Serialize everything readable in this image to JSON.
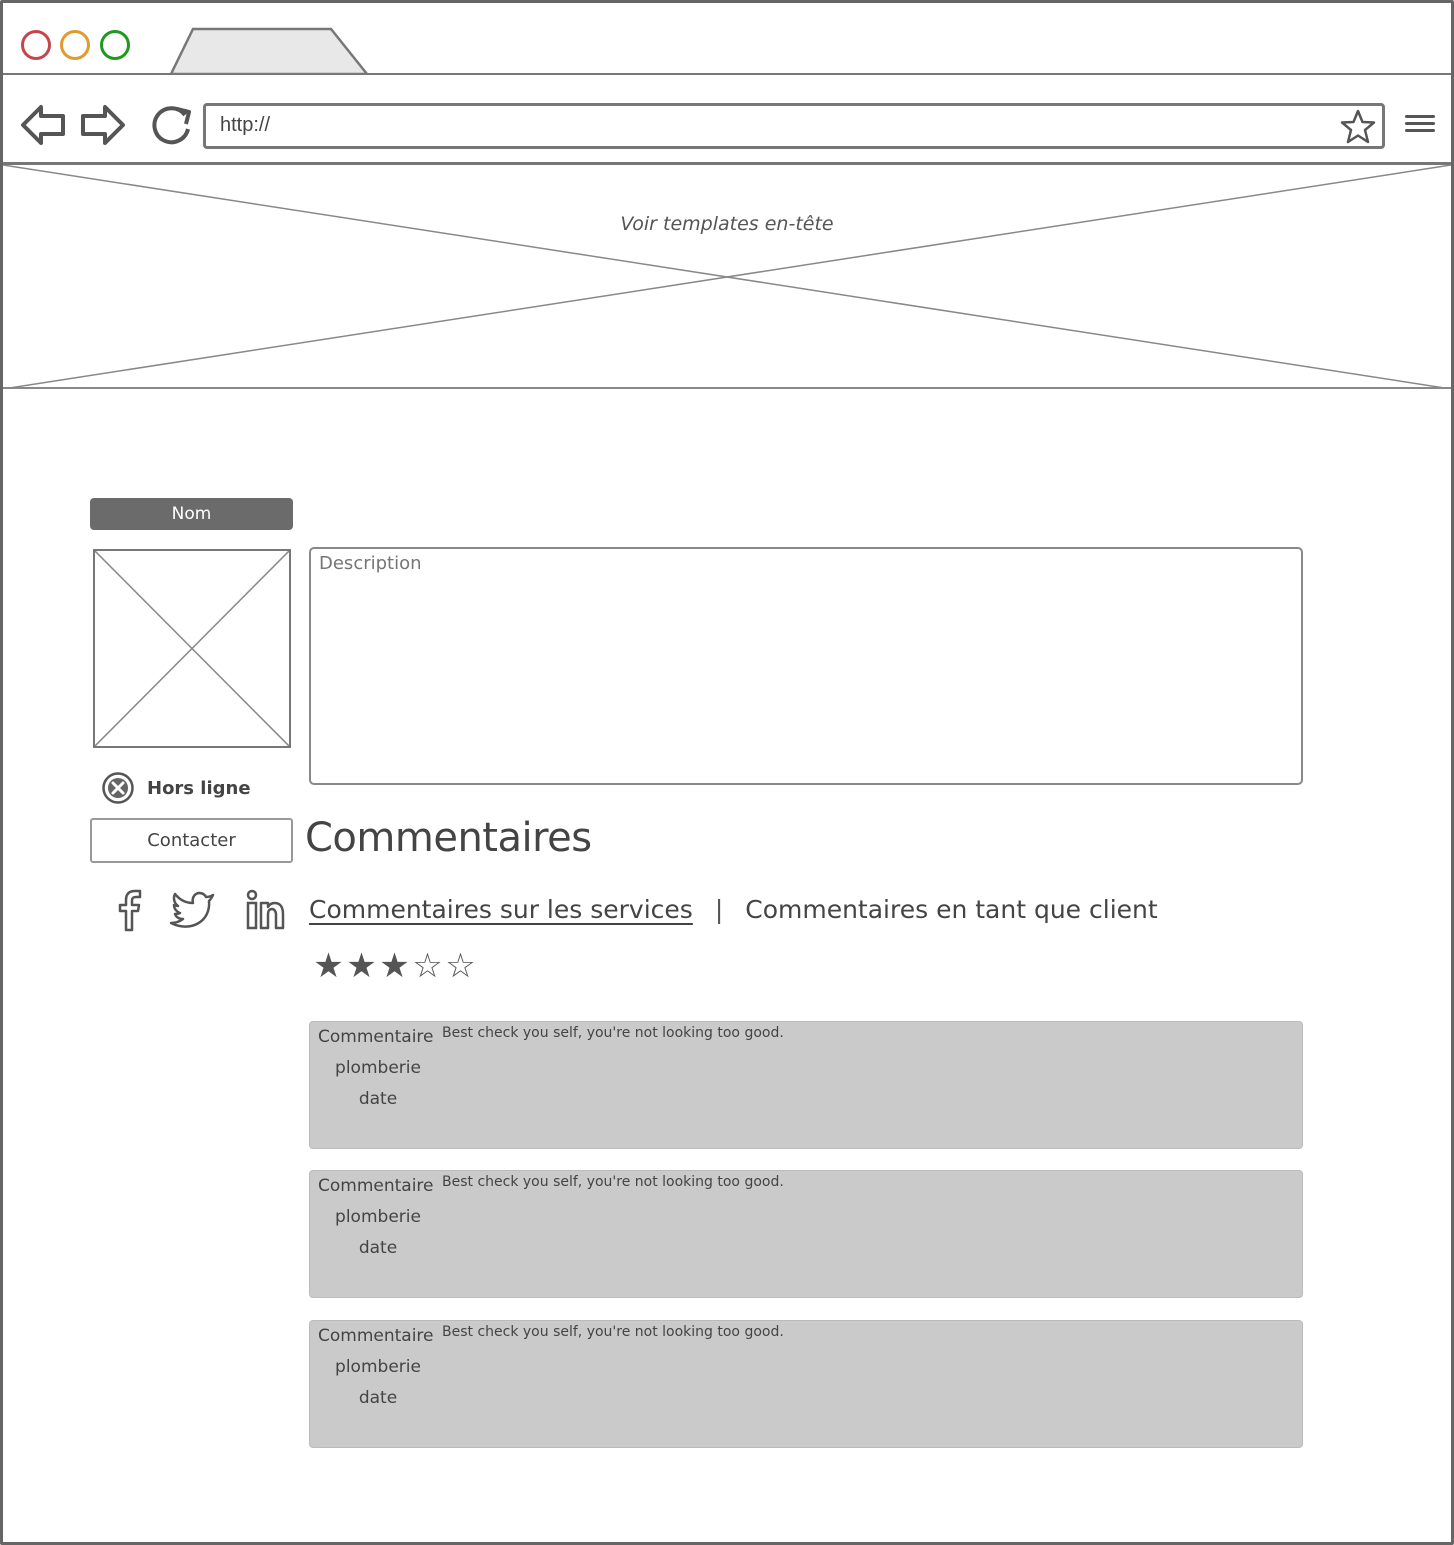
{
  "browser": {
    "url": "http://",
    "window_dots": [
      "#c4464a",
      "#e09a2e",
      "#1e9a1e"
    ]
  },
  "header": {
    "placeholder_label": "Voir templates en-tête"
  },
  "profile": {
    "name_label": "Nom",
    "status_label": "Hors ligne",
    "contact_label": "Contacter",
    "description_placeholder": "Description",
    "socials": [
      "facebook-icon",
      "twitter-icon",
      "linkedin-icon"
    ]
  },
  "comments": {
    "title": "Commentaires",
    "tabs": {
      "services": "Commentaires sur les services",
      "separator": "|",
      "client": "Commentaires en tant que client"
    },
    "rating": {
      "value": 3,
      "max": 5
    },
    "items": [
      {
        "title": "Commentaire",
        "category": "plomberie",
        "date": "date",
        "text": "Best check you self, you're not looking too good."
      },
      {
        "title": "Commentaire",
        "category": "plomberie",
        "date": "date",
        "text": "Best check you self, you're not looking too good."
      },
      {
        "title": "Commentaire",
        "category": "plomberie",
        "date": "date",
        "text": "Best check you self, you're not looking too good."
      }
    ]
  }
}
